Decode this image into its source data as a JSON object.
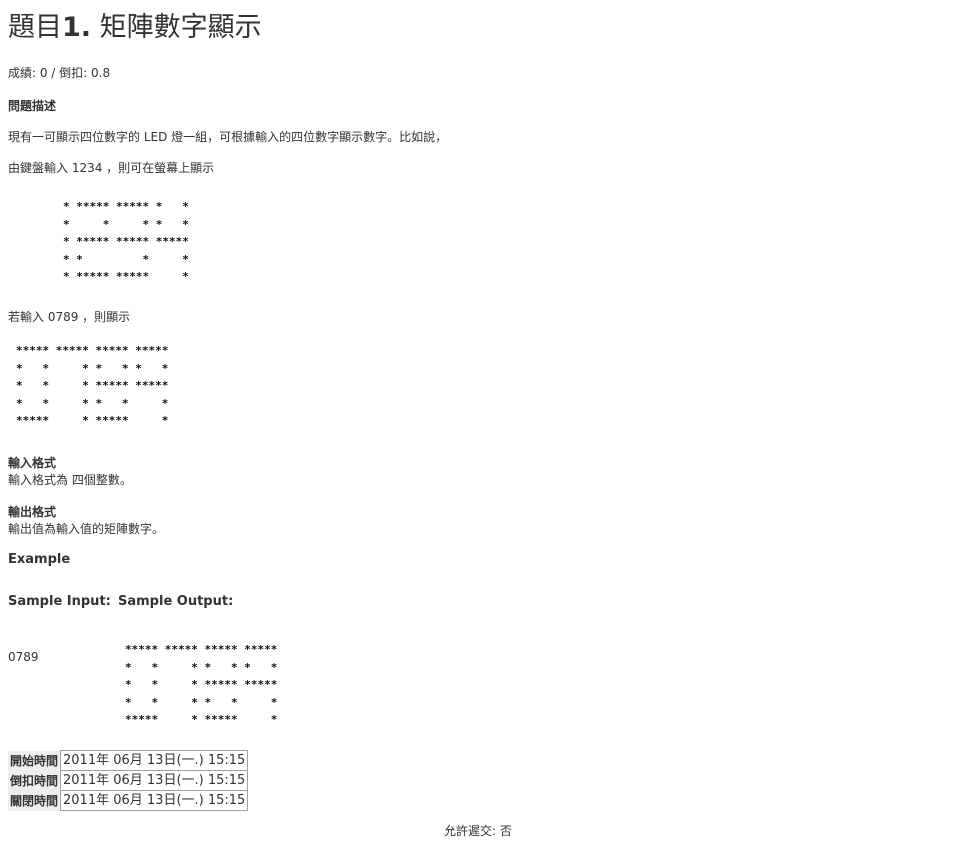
{
  "problem": {
    "title_prefix": "題目",
    "title_number": "1.",
    "title_name": " 矩陣數字顯示",
    "score_line": "成績: 0 / 倒扣: 0.8"
  },
  "description": {
    "label": "問題描述",
    "line1": "現有一可顯示四位數字的 LED 燈一組，可根據輸入的四位數字顯示數字。比如說，",
    "line2": "由鍵盤輸入 1234 ，則可在螢幕上顯示",
    "art_1234": "* ***** ***** *   *\n*     *     * *   *\n* ***** ***** *****\n* *         *     *\n* ***** *****     *",
    "line3": "若輸入 0789 ，則顯示",
    "art_0789": "***** ***** ***** *****\n*   *     * *   * *   *\n*   *     * ***** *****\n*   *     * *   *     *\n*****     * *****     *"
  },
  "input_format": {
    "label": "輸入格式",
    "text": "輸入格式為 四個整數。"
  },
  "output_format": {
    "label": "輸出格式",
    "text": "輸出值為輸入值的矩陣數字。"
  },
  "example": {
    "heading": "Example",
    "sample_input_label": "Sample Input:",
    "sample_output_label": "Sample Output:",
    "sample_input": "0789",
    "sample_output": "***** ***** ***** *****\n*   *     * *   * *   *\n*   *     * ***** *****\n*   *     * *   *     *\n*****     * *****     *"
  },
  "times": [
    {
      "label": "開始時間",
      "value": "2011年 06月 13日(一.) 15:15"
    },
    {
      "label": "倒扣時間",
      "value": "2011年 06月 13日(一.) 15:15"
    },
    {
      "label": "關閉時間",
      "value": "2011年 06月 13日(一.) 15:15"
    }
  ],
  "footer": {
    "submit_note": "允許遲交: 否"
  }
}
